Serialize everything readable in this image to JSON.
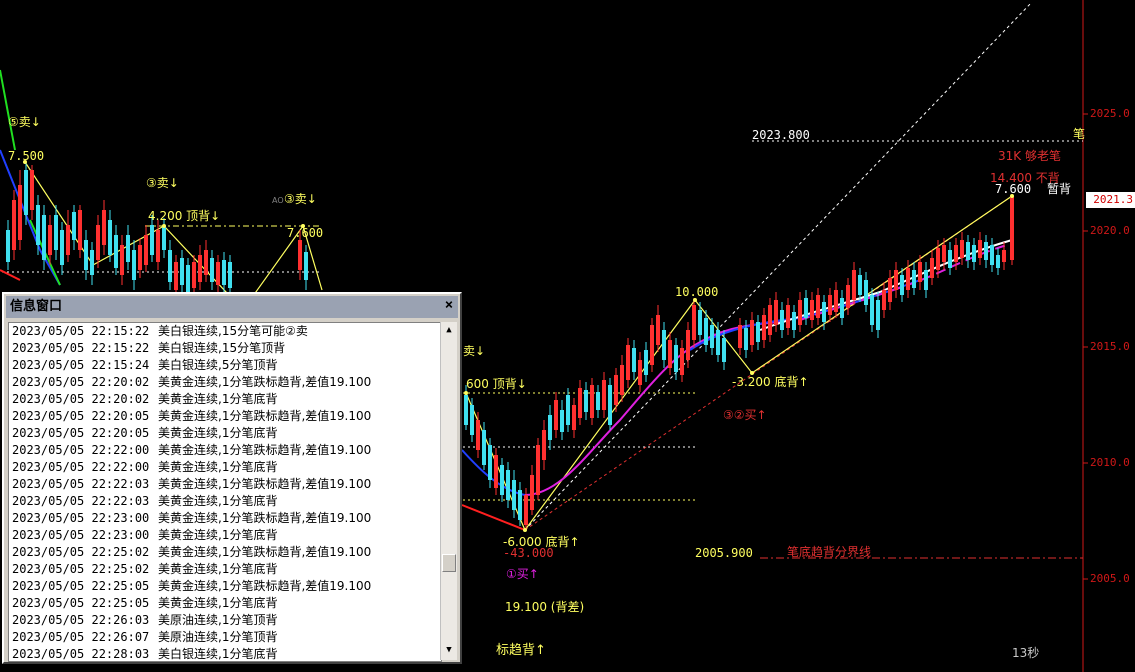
{
  "chart": {
    "y_axis_labels": [
      "2025.0",
      "2020.0",
      "2015.0",
      "2010.0",
      "2005.0"
    ],
    "current_price_tag": "2021.3",
    "annotations": {
      "sell5": "⑤卖↓",
      "val_7500": "7.500",
      "sell3a": "③卖↓",
      "top_div_4200": "4.200 顶背↓",
      "sell3b": "③卖↓",
      "sell3b_prefix": "AO",
      "val_7600a": "7.600",
      "sell_mid": "卖↓",
      "top_div_600": "600 顶背↓",
      "val_10000": "10.000",
      "bottom_3200": "-3.200 底背↑",
      "buy_32": "③②买↑",
      "bottom_6000": "-6.000 底背↑",
      "val_43000": "-43.000",
      "buy1": "①买↑",
      "val_2005900": "2005.900",
      "divider_label": "笔底趋背分界线",
      "diff_19100": "19.100 (背差)",
      "trend_div": "标趋背↑",
      "val_2023800": "2023.800",
      "edge_char": "笔",
      "strong_31k": "31K 够老笔",
      "val_14400": "14.400 不背",
      "val_7600b": "7.600",
      "pause_div": "暂背",
      "timer": "13秒"
    }
  },
  "info_window": {
    "title": "信息窗口",
    "close_label": "×",
    "scroll_up": "▲",
    "scroll_down": "▼",
    "rows": [
      {
        "time": "2023/05/05 22:15:22",
        "msg": "美白银连续,15分笔可能②卖"
      },
      {
        "time": "2023/05/05 22:15:22",
        "msg": "美白银连续,15分笔顶背"
      },
      {
        "time": "2023/05/05 22:15:24",
        "msg": "美白银连续,5分笔顶背"
      },
      {
        "time": "2023/05/05 22:20:02",
        "msg": "美黄金连续,1分笔跌标趋背,差值19.100"
      },
      {
        "time": "2023/05/05 22:20:02",
        "msg": "美黄金连续,1分笔底背"
      },
      {
        "time": "2023/05/05 22:20:05",
        "msg": "美黄金连续,1分笔跌标趋背,差值19.100"
      },
      {
        "time": "2023/05/05 22:20:05",
        "msg": "美黄金连续,1分笔底背"
      },
      {
        "time": "2023/05/05 22:22:00",
        "msg": "美黄金连续,1分笔跌标趋背,差值19.100"
      },
      {
        "time": "2023/05/05 22:22:00",
        "msg": "美黄金连续,1分笔底背"
      },
      {
        "time": "2023/05/05 22:22:03",
        "msg": "美黄金连续,1分笔跌标趋背,差值19.100"
      },
      {
        "time": "2023/05/05 22:22:03",
        "msg": "美黄金连续,1分笔底背"
      },
      {
        "time": "2023/05/05 22:23:00",
        "msg": "美黄金连续,1分笔跌标趋背,差值19.100"
      },
      {
        "time": "2023/05/05 22:23:00",
        "msg": "美黄金连续,1分笔底背"
      },
      {
        "time": "2023/05/05 22:25:02",
        "msg": "美黄金连续,1分笔跌标趋背,差值19.100"
      },
      {
        "time": "2023/05/05 22:25:02",
        "msg": "美黄金连续,1分笔底背"
      },
      {
        "time": "2023/05/05 22:25:05",
        "msg": "美黄金连续,1分笔跌标趋背,差值19.100"
      },
      {
        "time": "2023/05/05 22:25:05",
        "msg": "美黄金连续,1分笔底背"
      },
      {
        "time": "2023/05/05 22:26:03",
        "msg": "美原油连续,1分笔顶背"
      },
      {
        "time": "2023/05/05 22:26:07",
        "msg": "美原油连续,1分笔顶背"
      },
      {
        "time": "2023/05/05 22:28:03",
        "msg": "美白银连续,1分笔底背"
      }
    ]
  },
  "colors": {
    "background": "#000000",
    "candle_up": "#ff3030",
    "candle_down": "#40e0f0",
    "annotation_yellow": "#ffff60",
    "annotation_red": "#e03030",
    "axis_red": "#d01818"
  }
}
